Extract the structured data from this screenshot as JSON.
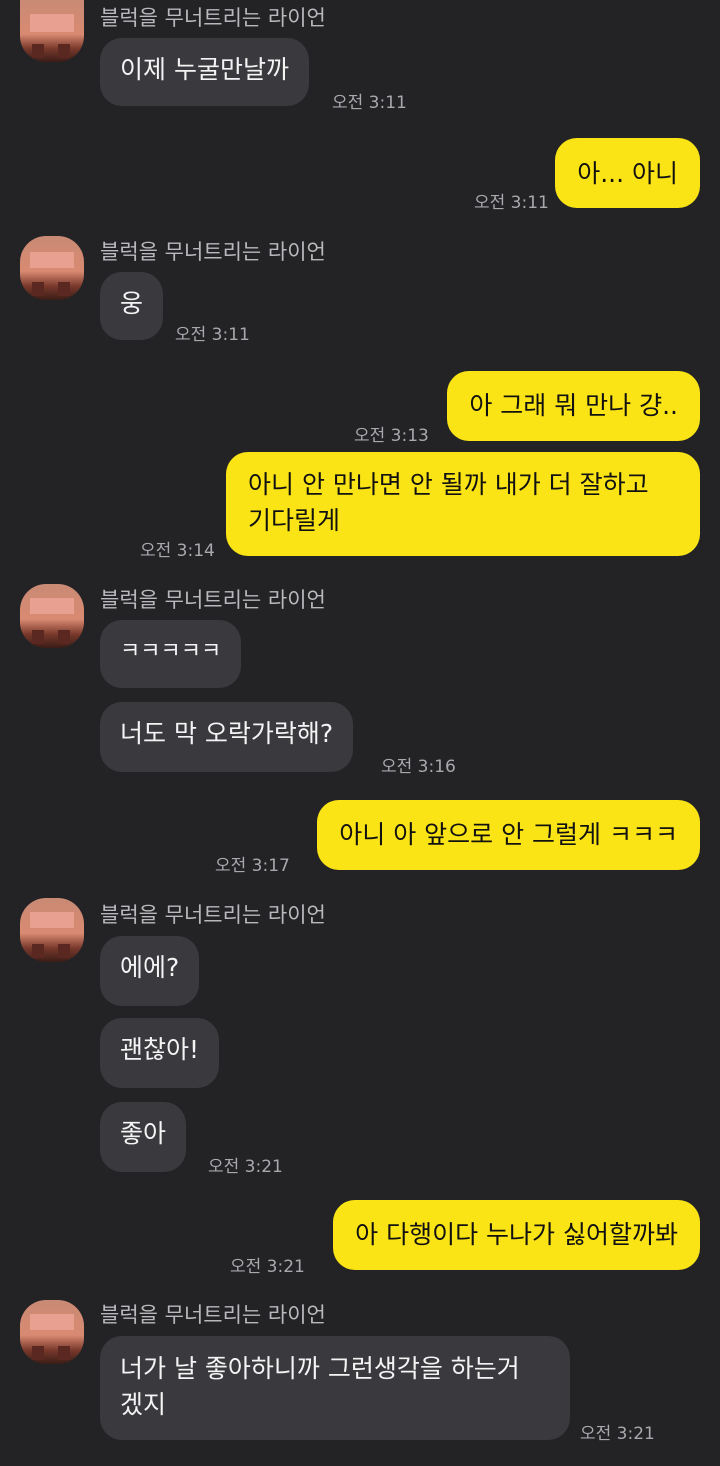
{
  "sender_name": "블럭을 무너트리는 라이언",
  "messages": [
    {
      "side": "recv",
      "text": "이제 누굴만날까",
      "time": "오전 3:11"
    },
    {
      "side": "sent",
      "text": "아... 아니",
      "time": "오전 3:11"
    },
    {
      "side": "recv",
      "text": "웅",
      "time": "오전 3:11"
    },
    {
      "side": "sent",
      "text": "아 그래 뭐 만나 걍..",
      "time": "오전 3:13"
    },
    {
      "side": "sent",
      "line1": "아니 안 만나면 안 될까 내가 더 잘하고",
      "line2": "기다릴게",
      "time": "오전 3:14"
    },
    {
      "side": "recv",
      "text": "ㅋㅋㅋㅋㅋ"
    },
    {
      "side": "recv",
      "text": "너도 막 오락가락해?",
      "time": "오전 3:16"
    },
    {
      "side": "sent",
      "text": "아니 아 앞으로 안 그럴게 ㅋㅋㅋ",
      "time": "오전 3:17"
    },
    {
      "side": "recv",
      "text": "에에?"
    },
    {
      "side": "recv",
      "text": "괜찮아!"
    },
    {
      "side": "recv",
      "text": "좋아",
      "time": "오전 3:21"
    },
    {
      "side": "sent",
      "text": "아 다행이다 누나가 싫어할까봐",
      "time": "오전 3:21"
    },
    {
      "side": "recv",
      "line1": "너가 날 좋아하니까 그런생각을 하는거",
      "line2": "겠지",
      "time": "오전 3:21"
    }
  ],
  "colors": {
    "background": "#232326",
    "received_bubble": "#3a3a3e",
    "sent_bubble": "#fbe415"
  },
  "avatar_icon": "pixelated-profile-avatar"
}
